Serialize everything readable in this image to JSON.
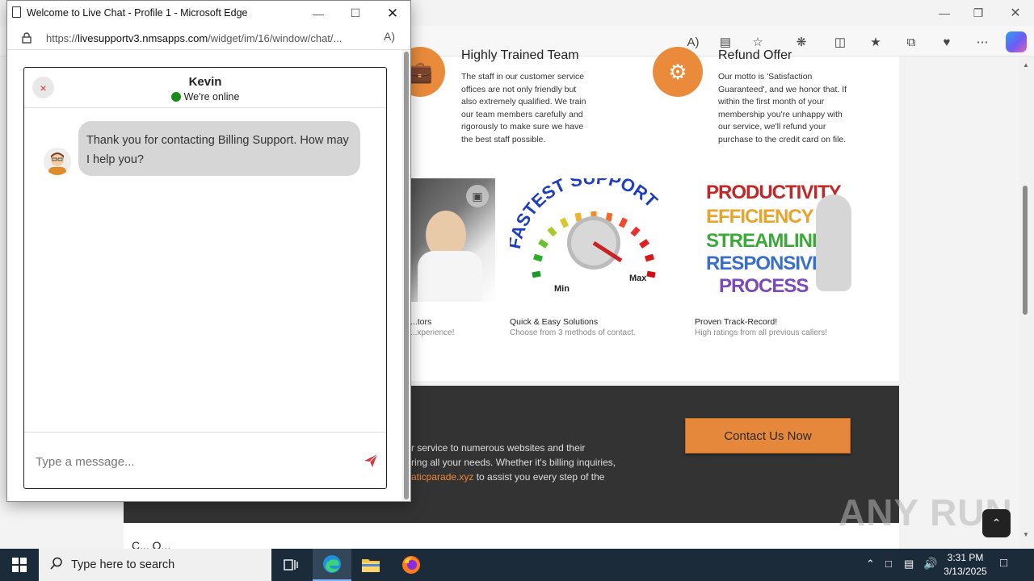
{
  "popup": {
    "title": "Welcome to Live Chat - Profile 1 - Microsoft Edge",
    "url_prefix": "https://",
    "url_host": "livesupportv3.nmsapps.com",
    "url_path": "/widget/im/16/window/chat/..."
  },
  "chat": {
    "agent_name": "Kevin",
    "status": "We're online",
    "close_label": "×",
    "messages": [
      {
        "sender": "agent",
        "text": "Thank you for contacting Billing Support. How may I help you?"
      }
    ],
    "input_placeholder": "Type a message..."
  },
  "background_page": {
    "features": [
      {
        "title": "Highly Trained Team",
        "text": "The staff in our customer service offices are not only friendly but also extremely qualified. We train our team members carefully and rigorously to make sure we have the best staff possible."
      },
      {
        "title": "Refund Offer",
        "text": "Our motto is 'Satisfaction Guaranteed', and we honor that. If within the first month of your membership you're unhappy with our service, we'll refund your purchase to the credit card on file."
      }
    ],
    "gallery": [
      {
        "title": "...tors",
        "subtitle": "...xperience!"
      },
      {
        "title": "Quick & Easy Solutions",
        "subtitle": "Choose from 3 methods of contact."
      },
      {
        "title": "Proven Track-Record!",
        "subtitle": "High ratings from all previous callers!"
      }
    ],
    "gauge_label": "FASTEST SUPPORT",
    "gauge_min": "Min",
    "gauge_max": "Max",
    "words_image": [
      "PRODUCTIVITY",
      "EFFICIENCY",
      "STREAMLINED",
      "RESPONSIVE",
      "PROCESS"
    ],
    "dark_lines": [
      "r service to numerous websites and their",
      "ring all your needs. Whether it's billing inquiries,"
    ],
    "dark_link": "aticparade.xyz",
    "dark_line3_rest": " to assist you every step of the",
    "contact_button": "Contact Us Now",
    "bottom_text": "C... Q..."
  },
  "taskbar": {
    "search_placeholder": "Type here to search",
    "time": "3:31 PM",
    "date": "3/13/2025"
  },
  "watermark": "ANY RUN",
  "colors": {
    "accent_orange": "#ea8b3b",
    "online_green": "#1a8a1a",
    "send_red": "#d9363e",
    "taskbar": "#1c2b3a"
  },
  "icons": [
    "document-icon",
    "minimize-icon",
    "maximize-icon",
    "close-icon",
    "lock-icon",
    "read-aloud-icon",
    "briefcase-icon",
    "gear-icon",
    "send-icon",
    "windows-icon",
    "search-icon",
    "task-view-icon",
    "edge-icon",
    "file-explorer-icon",
    "firefox-icon"
  ]
}
